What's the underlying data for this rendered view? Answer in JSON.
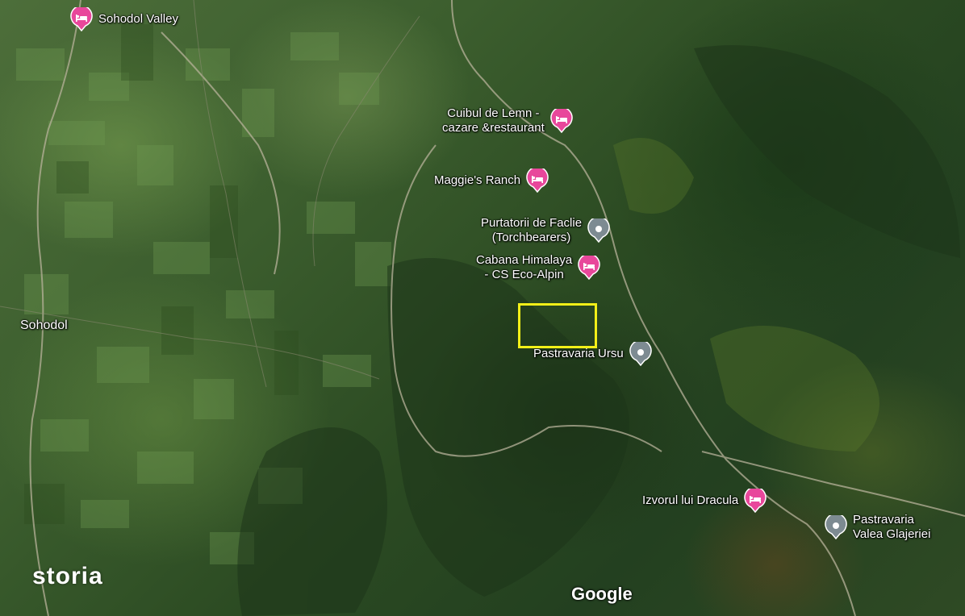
{
  "map": {
    "type": "satellite",
    "colors": {
      "hotel_pin": "#e8479b",
      "place_pin": "#7d8b92",
      "highlight": "#f2ef18"
    },
    "places": [
      {
        "id": "sohodol",
        "label": "Sohodol"
      }
    ],
    "pois": [
      {
        "id": "sohodol-valley",
        "label": "Sohodol Valley",
        "kind": "hotel",
        "icon": "bed-icon"
      },
      {
        "id": "cuibul-de-lemn",
        "label": "Cuibul de Lemn -\ncazare &restaurant",
        "kind": "hotel",
        "icon": "bed-icon"
      },
      {
        "id": "maggies-ranch",
        "label": "Maggie's Ranch",
        "kind": "hotel",
        "icon": "bed-icon"
      },
      {
        "id": "purtatorii-de-faclie",
        "label": "Purtatorii de Faclie\n(Torchbearers)",
        "kind": "place",
        "icon": "location-pin-icon"
      },
      {
        "id": "cabana-himalaya",
        "label": "Cabana Himalaya\n- CS Eco-Alpin",
        "kind": "hotel",
        "icon": "bed-icon"
      },
      {
        "id": "pastravaria-ursu",
        "label": "Pastravaria Ursu",
        "kind": "place",
        "icon": "location-pin-icon"
      },
      {
        "id": "izvorul-lui-dracula",
        "label": "Izvorul lui Dracula",
        "kind": "hotel",
        "icon": "bed-icon"
      },
      {
        "id": "pastravaria-valea-glajeriei",
        "label": "Pastravaria\nValea Glajeriei",
        "kind": "place",
        "icon": "location-pin-icon"
      }
    ],
    "watermark": "storia",
    "attribution": "Google"
  }
}
